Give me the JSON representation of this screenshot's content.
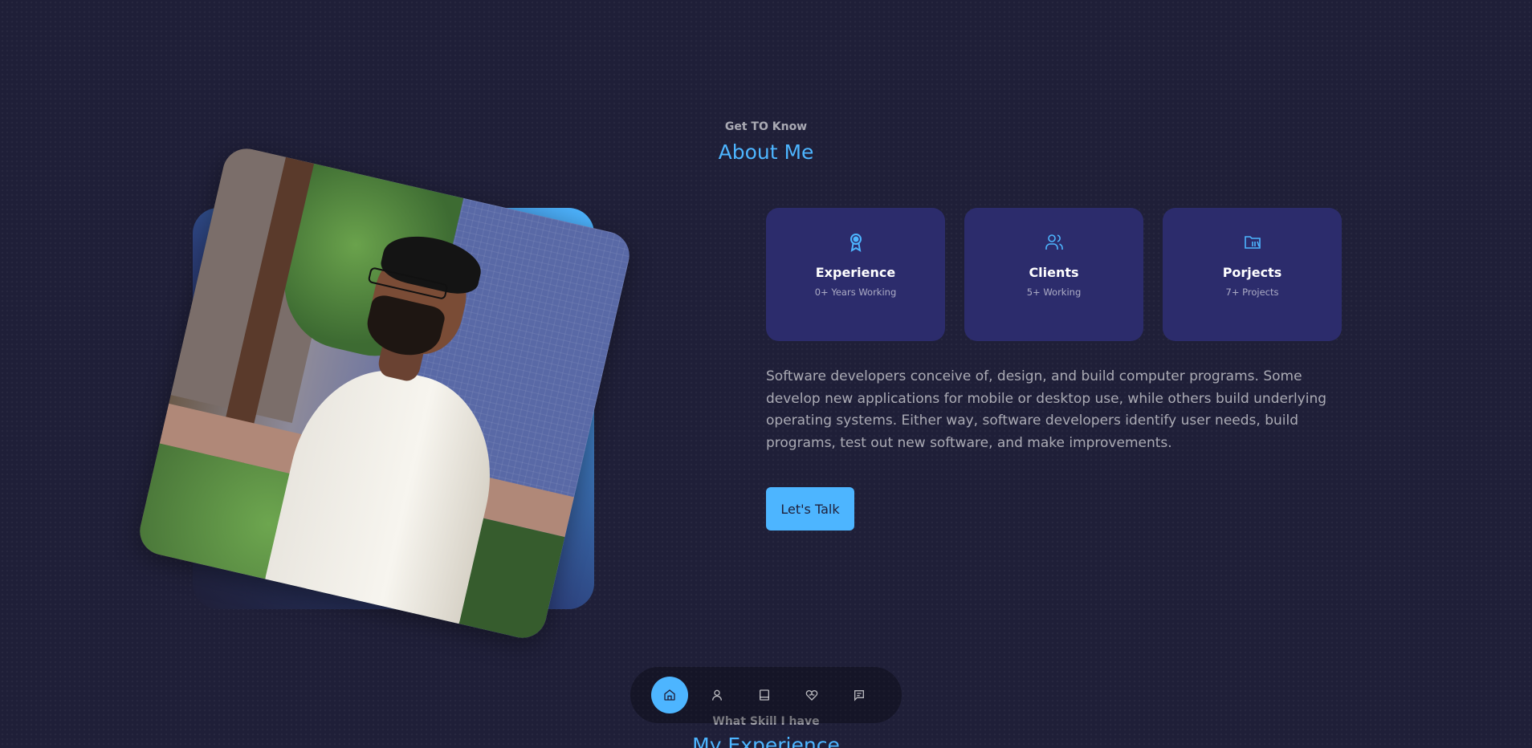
{
  "about": {
    "eyebrow": "Get TO Know",
    "title": "About Me",
    "cards": [
      {
        "icon": "award-icon",
        "title": "Experience",
        "subtitle": "0+ Years Working"
      },
      {
        "icon": "users-icon",
        "title": "Clients",
        "subtitle": "5+ Working"
      },
      {
        "icon": "folder-icon",
        "title": "Porjects",
        "subtitle": "7+ Projects"
      }
    ],
    "paragraph": "Software developers conceive of, design, and build computer programs. Some develop new applications for mobile or desktop use, while others build underlying operating systems. Either way, software developers identify user needs, build programs, test out new software, and make improvements.",
    "cta_label": "Let's Talk"
  },
  "next_section": {
    "eyebrow": "What Skill I have",
    "title": "My Experience"
  },
  "nav": {
    "items": [
      {
        "icon": "home-icon",
        "active": true
      },
      {
        "icon": "user-icon",
        "active": false
      },
      {
        "icon": "book-icon",
        "active": false
      },
      {
        "icon": "services-icon",
        "active": false
      },
      {
        "icon": "message-icon",
        "active": false
      }
    ]
  },
  "colors": {
    "background": "#1f1f38",
    "primary": "#4db5ff",
    "card": "#2c2c6c"
  }
}
